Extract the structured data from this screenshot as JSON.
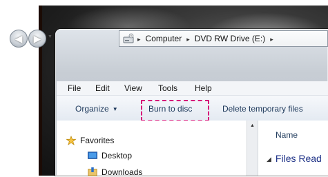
{
  "address_bar": {
    "crumbs": [
      "Computer",
      "DVD RW Drive (E:)"
    ],
    "separator": "▸",
    "dropdown": "▸"
  },
  "menu": {
    "items": [
      "File",
      "Edit",
      "View",
      "Tools",
      "Help"
    ]
  },
  "toolbar": {
    "organize": "Organize",
    "burn": "Burn to disc",
    "delete_temp": "Delete temporary files"
  },
  "nav_pane": {
    "favorites": "Favorites",
    "items": [
      "Desktop",
      "Downloads"
    ]
  },
  "content": {
    "column_name": "Name",
    "group_header": "Files Read"
  },
  "colors": {
    "highlight": "#d6157a",
    "command_text": "#1e395b",
    "group_text": "#1e3287"
  }
}
